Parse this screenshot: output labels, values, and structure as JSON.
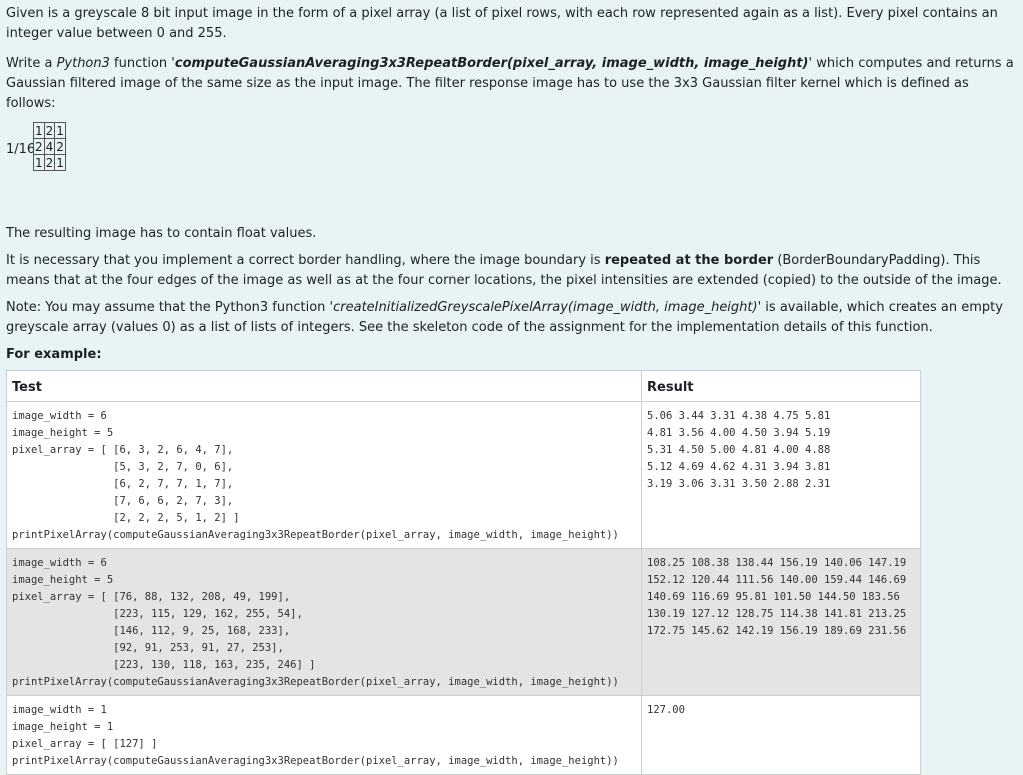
{
  "intro": {
    "p1": "Given is a greyscale 8 bit input image in the form of a pixel array (a list of pixel rows, with each row represented again as a list). Every pixel contains an integer value between 0 and 255.",
    "p2_a": "Write a ",
    "p2_python": "Python3",
    "p2_b": " function '",
    "p2_func": "computeGaussianAveraging3x3RepeatBorder(pixel_array, image_width, image_height)",
    "p2_c": "' which computes and returns a Gaussian filtered image of the same size as the input image. The filter response image has to use the 3x3 Gaussian filter kernel which is defined as follows:"
  },
  "kernel": {
    "factor": "1/16",
    "rows": [
      [
        "1",
        "2",
        "1"
      ],
      [
        "2",
        "4",
        "2"
      ],
      [
        "1",
        "2",
        "1"
      ]
    ]
  },
  "p3": "The resulting image has to contain float values.",
  "p4": {
    "a": "It is necessary that you implement a correct border handling, where the image boundary is ",
    "b": "repeated at the border",
    "c": " (BorderBoundaryPadding). This means that at the four edges of the image as well as at the four corner locations, the pixel intensities are extended (copied) to the outside of the image."
  },
  "p5": {
    "a": "Note: You may assume that the Python3 function '",
    "b": "createInitializedGreyscalePixelArray(image_width, image_height)",
    "c": "' is available, which creates an empty greyscale array (values 0) as a list of lists of integers. See the skeleton code of the assignment for the implementation details of this function."
  },
  "example_title": "For example:",
  "table": {
    "headers": [
      "Test",
      "Result"
    ],
    "rows": [
      {
        "test": "image_width = 6\nimage_height = 5\npixel_array = [ [6, 3, 2, 6, 4, 7],\n                [5, 3, 2, 7, 0, 6],\n                [6, 2, 7, 7, 1, 7],\n                [7, 6, 6, 2, 7, 3],\n                [2, 2, 2, 5, 1, 2] ]\nprintPixelArray(computeGaussianAveraging3x3RepeatBorder(pixel_array, image_width, image_height))",
        "result": "5.06 3.44 3.31 4.38 4.75 5.81\n4.81 3.56 4.00 4.50 3.94 5.19\n5.31 4.50 5.00 4.81 4.00 4.88\n5.12 4.69 4.62 4.31 3.94 3.81\n3.19 3.06 3.31 3.50 2.88 2.31"
      },
      {
        "test": "image_width = 6\nimage_height = 5\npixel_array = [ [76, 88, 132, 208, 49, 199],\n                [223, 115, 129, 162, 255, 54],\n                [146, 112, 9, 25, 168, 233],\n                [92, 91, 253, 91, 27, 253],\n                [223, 130, 118, 163, 235, 246] ]\nprintPixelArray(computeGaussianAveraging3x3RepeatBorder(pixel_array, image_width, image_height))",
        "result": "108.25 108.38 138.44 156.19 140.06 147.19\n152.12 120.44 111.56 140.00 159.44 146.69\n140.69 116.69 95.81 101.50 144.50 183.56\n130.19 127.12 128.75 114.38 141.81 213.25\n172.75 145.62 142.19 156.19 189.69 231.56"
      },
      {
        "test": "image_width = 1\nimage_height = 1\npixel_array = [ [127] ]\nprintPixelArray(computeGaussianAveraging3x3RepeatBorder(pixel_array, image_width, image_height))",
        "result": "127.00"
      }
    ]
  }
}
